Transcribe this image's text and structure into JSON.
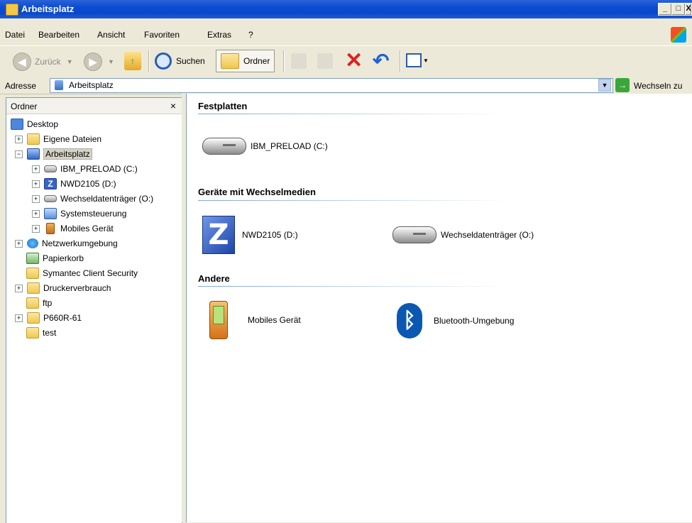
{
  "window": {
    "title": "Arbeitsplatz",
    "controls": [
      "_",
      "□",
      "X"
    ]
  },
  "menu": [
    "Datei",
    "Bearbeiten",
    "Ansicht",
    "Favoriten",
    "Extras",
    "?"
  ],
  "toolbar": {
    "back": "Zurück",
    "search": "Suchen",
    "folders": "Ordner"
  },
  "address": {
    "label": "Adresse",
    "value": "Arbeitsplatz",
    "go": "Wechseln zu"
  },
  "tree": {
    "header": "Ordner",
    "close": "×",
    "expand": "+",
    "collapse": "−",
    "nodes": [
      "Desktop",
      "Eigene Dateien",
      "Arbeitsplatz",
      "IBM_PRELOAD (C:)",
      "NWD2105 (D:)",
      "Wechseldatenträger (O:)",
      "Systemsteuerung",
      "Mobiles Gerät",
      "Netzwerkumgebung",
      "Papierkorb",
      "Symantec Client Security",
      "Druckerverbrauch",
      "ftp",
      "P660R-61",
      "test"
    ]
  },
  "content": {
    "groups": [
      {
        "title": "Festplatten",
        "items": [
          "IBM_PRELOAD (C:)"
        ]
      },
      {
        "title": "Geräte mit Wechselmedien",
        "items": [
          "NWD2105 (D:)",
          "Wechseldatenträger (O:)"
        ]
      },
      {
        "title": "Andere",
        "items": [
          "Mobiles Gerät",
          "Bluetooth-Umgebung"
        ]
      }
    ],
    "glyphs": {
      "z": "Z",
      "bluetooth": "ᛒ"
    }
  }
}
